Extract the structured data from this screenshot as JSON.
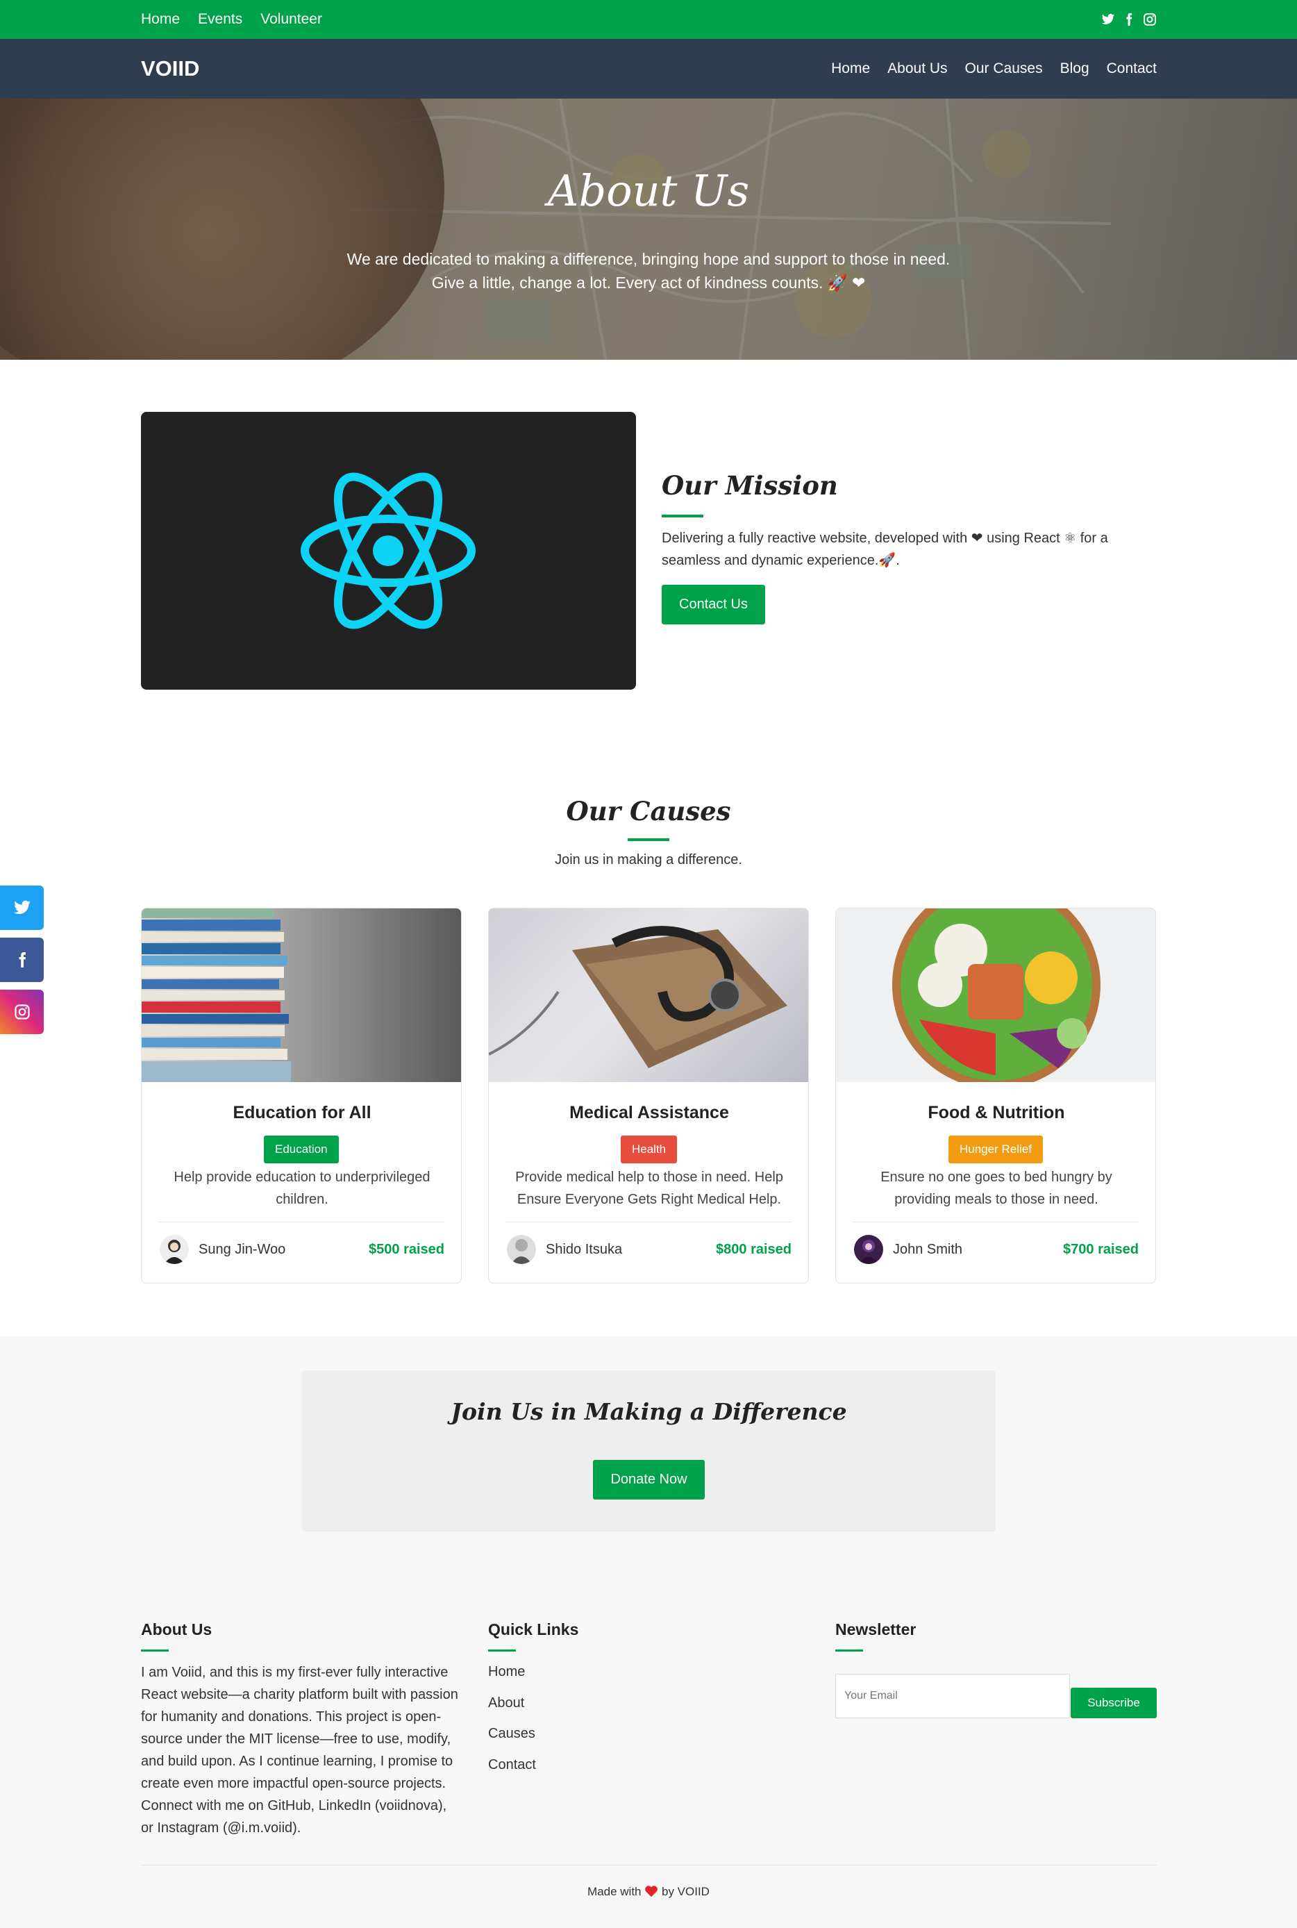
{
  "topbar": {
    "links": [
      "Home",
      "Events",
      "Volunteer"
    ],
    "social_icons": [
      "twitter-icon",
      "facebook-icon",
      "instagram-icon"
    ]
  },
  "navbar": {
    "brand": "VOIID",
    "links": [
      "Home",
      "About Us",
      "Our Causes",
      "Blog",
      "Contact"
    ]
  },
  "hero": {
    "title": "About Us",
    "line1": "We are dedicated to making a difference, bringing hope and support to those in need.",
    "line2": "Give a little, change a lot. Every act of kindness counts. 🚀 ❤"
  },
  "mission": {
    "title": "Our Mission",
    "text": "Delivering a fully reactive website, developed with ❤ using React ⚛ for a seamless and dynamic experience.🚀.",
    "button": "Contact Us"
  },
  "causes": {
    "title": "Our Causes",
    "subtitle": "Join us in making a difference.",
    "cards": [
      {
        "title": "Education for All",
        "tag": "Education",
        "tag_color": "#00a14b",
        "desc": "Help provide education to underprivileged children.",
        "author": "Sung Jin-Woo",
        "raised": "$500 raised"
      },
      {
        "title": "Medical Assistance",
        "tag": "Health",
        "tag_color": "#e74c3c",
        "desc": "Provide medical help to those in need. Help Ensure Everyone Gets Right Medical Help.",
        "author": "Shido Itsuka",
        "raised": "$800 raised"
      },
      {
        "title": "Food & Nutrition",
        "tag": "Hunger Relief",
        "tag_color": "#f39c12",
        "desc": "Ensure no one goes to bed hungry by providing meals to those in need.",
        "author": "John Smith",
        "raised": "$700 raised"
      }
    ]
  },
  "side_social": [
    {
      "icon": "twitter-icon",
      "color": "#1da1f2"
    },
    {
      "icon": "facebook-icon",
      "color": "#3b5998"
    },
    {
      "icon": "instagram-icon",
      "color": "#d6246e"
    }
  ],
  "join": {
    "title": "Join Us in Making a Difference",
    "button": "Donate Now"
  },
  "footer": {
    "about_title": "About Us",
    "about_text": "I am Voiid, and this is my first-ever fully interactive React website—a charity platform built with passion for humanity and donations. This project is open-source under the MIT license—free to use, modify, and build upon. As I continue learning, I promise to create even more impactful open-source projects. Connect with me on GitHub, LinkedIn (voiidnova), or Instagram (@i.m.voiid).",
    "links_title": "Quick Links",
    "links": [
      "Home",
      "About",
      "Causes",
      "Contact"
    ],
    "newsletter_title": "Newsletter",
    "email_placeholder": "Your Email",
    "subscribe": "Subscribe",
    "made_with_prefix": "Made with",
    "made_with_suffix": "by VOIID"
  },
  "colors": {
    "accent": "#00a14b",
    "nav_bg": "#2f3d51"
  }
}
